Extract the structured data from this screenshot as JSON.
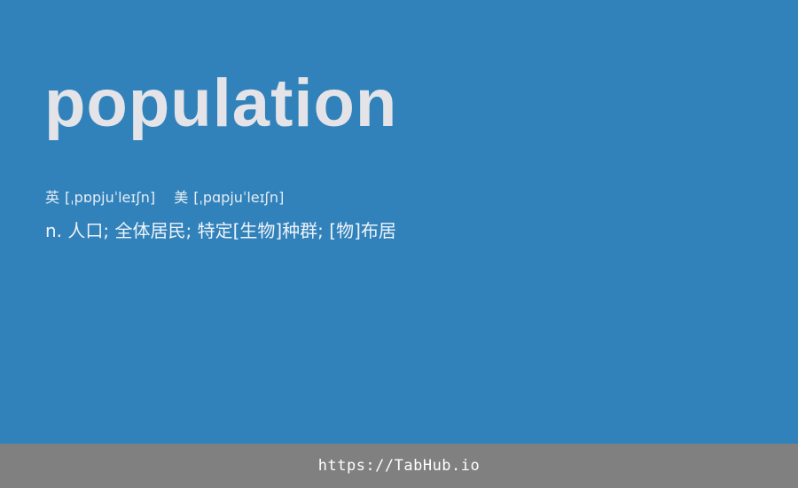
{
  "card": {
    "word": "population",
    "phonetics": [
      {
        "lang": "英",
        "ipa": "[ˌpɒpjuˈleɪʃn]"
      },
      {
        "lang": "美",
        "ipa": "[ˌpɑpjuˈleɪʃn]"
      }
    ],
    "definition": "n. 人口; 全体居民; 特定[生物]种群; [物]布居"
  },
  "footer": {
    "url": "https://TabHub.io"
  },
  "colors": {
    "background": "#3182bb",
    "word": "#e4e4e8",
    "footer": "#808080"
  }
}
